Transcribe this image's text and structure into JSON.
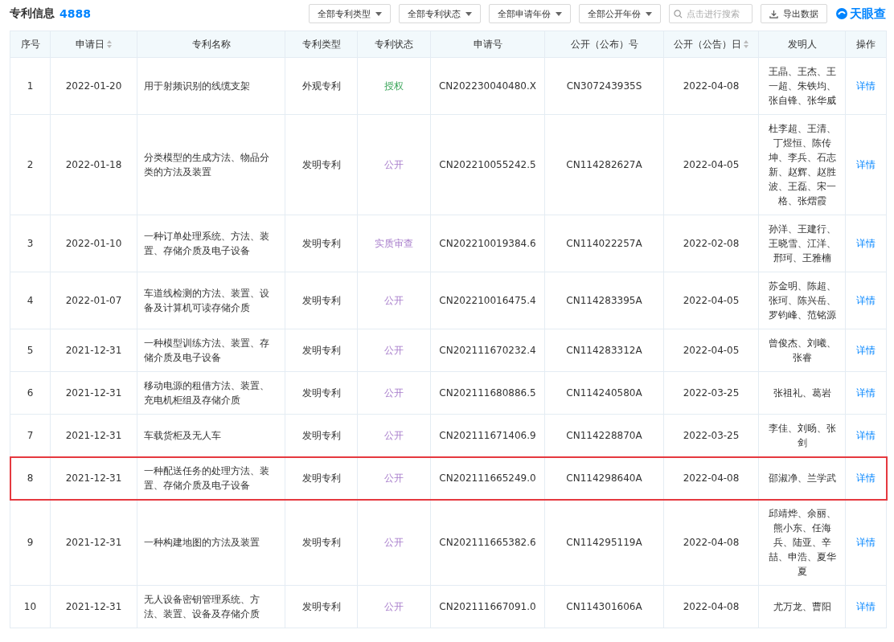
{
  "header": {
    "title": "专利信息",
    "count": "4888",
    "filters": [
      "全部专利类型",
      "全部专利状态",
      "全部申请年份",
      "全部公开年份"
    ],
    "search": {
      "placeholder": "点击进行搜索"
    },
    "export_button": "导出数据",
    "logo": "天眼查"
  },
  "table": {
    "columns": [
      {
        "label": "序号",
        "sortable": false
      },
      {
        "label": "申请日",
        "sortable": true
      },
      {
        "label": "专利名称",
        "sortable": false
      },
      {
        "label": "专利类型",
        "sortable": false
      },
      {
        "label": "专利状态",
        "sortable": false
      },
      {
        "label": "申请号",
        "sortable": false
      },
      {
        "label": "公开（公布）号",
        "sortable": false
      },
      {
        "label": "公开（公告）日",
        "sortable": true
      },
      {
        "label": "发明人",
        "sortable": false
      },
      {
        "label": "操作",
        "sortable": false
      }
    ],
    "rows": [
      {
        "no": "1",
        "date": "2022-01-20",
        "name": "用于射频识别的线缆支架",
        "type": "外观专利",
        "status": "授权",
        "color": "#3aa55a",
        "app_no": "CN202230040480.X",
        "pub_no": "CN307243935S",
        "pub_date": "2022-04-08",
        "inventors": "王晶、王杰、王一超、朱铁均、张自锋、张华威",
        "action": "详情",
        "highlighted": false
      },
      {
        "no": "2",
        "date": "2022-01-18",
        "name": "分类模型的生成方法、物品分类的方法及装置",
        "type": "发明专利",
        "status": "公开",
        "color": "#a77ccb",
        "app_no": "CN202210055242.5",
        "pub_no": "CN114282627A",
        "pub_date": "2022-04-05",
        "inventors": "杜李超、王清、丁煜恒、陈传坤、李兵、石志新、赵辉、赵胜波、王磊、宋一格、张熠霞",
        "action": "详情",
        "highlighted": false
      },
      {
        "no": "3",
        "date": "2022-01-10",
        "name": "一种订单处理系统、方法、装置、存储介质及电子设备",
        "type": "发明专利",
        "status": "实质审查",
        "color": "#a77ccb",
        "app_no": "CN202210019384.6",
        "pub_no": "CN114022257A",
        "pub_date": "2022-02-08",
        "inventors": "孙洋、王建行、王晓雪、江洋、邢珂、王雅楠",
        "action": "详情",
        "highlighted": false
      },
      {
        "no": "4",
        "date": "2022-01-07",
        "name": "车道线检测的方法、装置、设备及计算机可读存储介质",
        "type": "发明专利",
        "status": "公开",
        "color": "#a77ccb",
        "app_no": "CN202210016475.4",
        "pub_no": "CN114283395A",
        "pub_date": "2022-04-05",
        "inventors": "苏金明、陈超、张珂、陈兴岳、罗钧峰、范铭源",
        "action": "详情",
        "highlighted": false
      },
      {
        "no": "5",
        "date": "2021-12-31",
        "name": "一种模型训练方法、装置、存储介质及电子设备",
        "type": "发明专利",
        "status": "公开",
        "color": "#a77ccb",
        "app_no": "CN202111670232.4",
        "pub_no": "CN114283312A",
        "pub_date": "2022-04-05",
        "inventors": "曾俊杰、刘曦、张睿",
        "action": "详情",
        "highlighted": false
      },
      {
        "no": "6",
        "date": "2021-12-31",
        "name": "移动电源的租借方法、装置、充电机柜组及存储介质",
        "type": "发明专利",
        "status": "公开",
        "color": "#a77ccb",
        "app_no": "CN202111680886.5",
        "pub_no": "CN114240580A",
        "pub_date": "2022-03-25",
        "inventors": "张祖礼、葛岩",
        "action": "详情",
        "highlighted": false
      },
      {
        "no": "7",
        "date": "2021-12-31",
        "name": "车载货柜及无人车",
        "type": "发明专利",
        "status": "公开",
        "color": "#a77ccb",
        "app_no": "CN202111671406.9",
        "pub_no": "CN114228870A",
        "pub_date": "2022-03-25",
        "inventors": "李佳、刘旸、张剑",
        "action": "详情",
        "highlighted": false
      },
      {
        "no": "8",
        "date": "2021-12-31",
        "name": "一种配送任务的处理方法、装置、存储介质及电子设备",
        "type": "发明专利",
        "status": "公开",
        "color": "#a77ccb",
        "app_no": "CN202111665249.0",
        "pub_no": "CN114298640A",
        "pub_date": "2022-04-08",
        "inventors": "邵淑净、兰学武",
        "action": "详情",
        "highlighted": true
      },
      {
        "no": "9",
        "date": "2021-12-31",
        "name": "一种构建地图的方法及装置",
        "type": "发明专利",
        "status": "公开",
        "color": "#a77ccb",
        "app_no": "CN202111665382.6",
        "pub_no": "CN114295119A",
        "pub_date": "2022-04-08",
        "inventors": "邱靖烨、余丽、熊小东、任海兵、陆亚、辛喆、申浩、夏华夏",
        "action": "详情",
        "highlighted": false
      },
      {
        "no": "10",
        "date": "2021-12-31",
        "name": "无人设备密钥管理系统、方法、装置、设备及存储介质",
        "type": "发明专利",
        "status": "公开",
        "color": "#a77ccb",
        "app_no": "CN202111667091.0",
        "pub_no": "CN114301606A",
        "pub_date": "2022-04-08",
        "inventors": "尤万龙、曹阳",
        "action": "详情",
        "highlighted": false
      }
    ]
  }
}
